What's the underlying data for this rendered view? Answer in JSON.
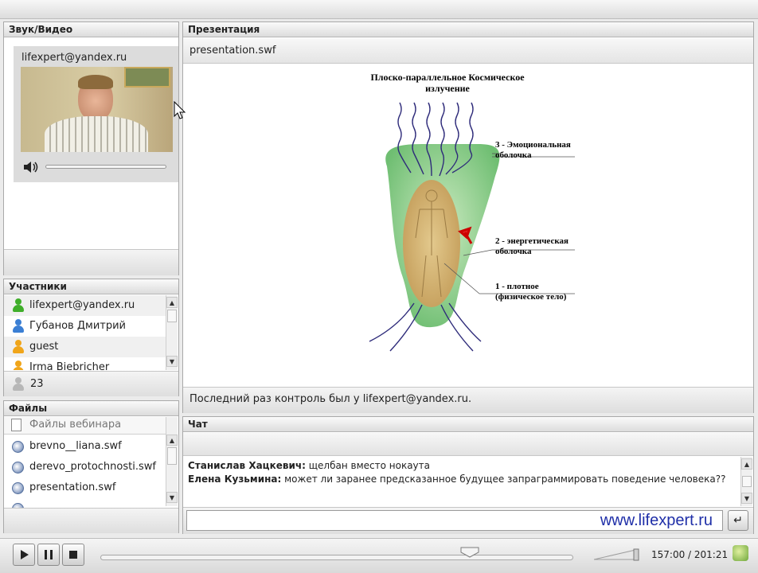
{
  "audio_video": {
    "title": "Звук/Видео",
    "user": "lifexpert@yandex.ru"
  },
  "presentation": {
    "title": "Презентация",
    "file": "presentation.swf",
    "slide": {
      "title_line1": "Плоско-параллельное Космическое",
      "title_line2": "излучение",
      "label3_line1": "3 - Эмоциональная",
      "label3_line2": "оболочка",
      "label2_line1": "2 - энергетическая",
      "label2_line2": "оболочка",
      "label1_line1": "1 - плотное",
      "label1_line2": "(физическое тело)"
    },
    "status": "Последний раз контроль был у lifexpert@yandex.ru."
  },
  "participants": {
    "title": "Участники",
    "items": [
      {
        "name": "lifexpert@yandex.ru",
        "color": "#3fae2a"
      },
      {
        "name": "Губанов Дмитрий",
        "color": "#3b7fd4"
      },
      {
        "name": "guest",
        "color": "#f0a51a"
      },
      {
        "name": "Irma Biebricher",
        "color": "#f0a51a"
      }
    ],
    "count": "23"
  },
  "files": {
    "title": "Файлы",
    "header": "Файлы вебинара",
    "items": [
      "brevno__liana.swf",
      "derevo_protochnosti.swf",
      "presentation.swf",
      "..."
    ]
  },
  "chat": {
    "title": "Чат",
    "messages": [
      {
        "author": "Станислав Хацкевич:",
        "text": "щелбан вместо нокаута"
      },
      {
        "author": "Елена Кузьмина:",
        "text": "может ли заранее предсказанное будущее запраграммировать поведение человека??"
      }
    ],
    "watermark": "www.lifexpert.ru"
  },
  "player": {
    "time": "157:00 / 201:21"
  },
  "colors": {
    "header_bg": "#e2e2e2",
    "brand_blue": "#1f2fa8",
    "outer_shell": "#7fc77f",
    "inner_shell": "#d7b06c",
    "ray": "#2e2b7a"
  }
}
